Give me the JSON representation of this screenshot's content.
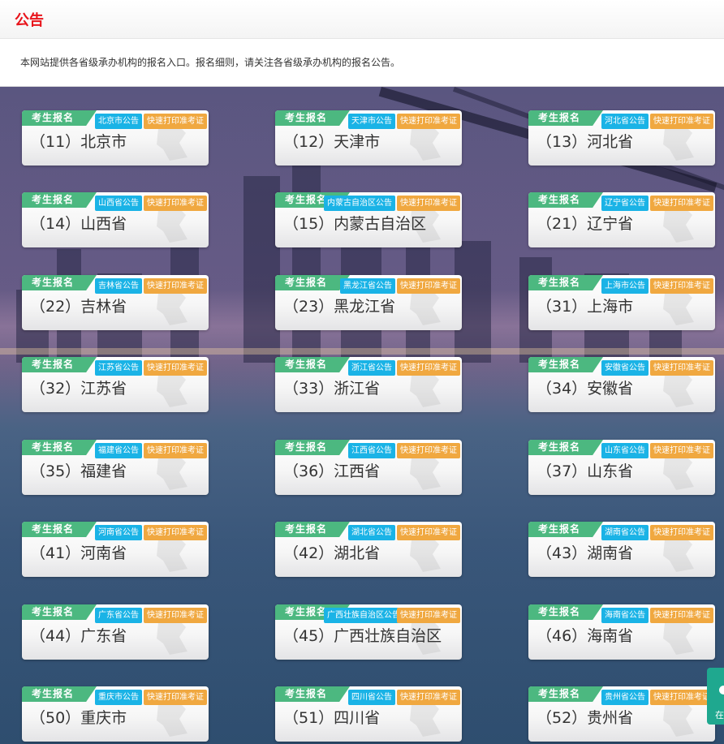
{
  "header": {
    "title": "公告",
    "notice": "本网站提供各省级承办机构的报名入口。报名细则，请关注各省级承办机构的报名公告。"
  },
  "card_common": {
    "ribbon": "考生报名",
    "print": "快速打印准考证"
  },
  "cards": [
    {
      "name": "（11）北京市",
      "notice": "北京市公告"
    },
    {
      "name": "（12）天津市",
      "notice": "天津市公告"
    },
    {
      "name": "（13）河北省",
      "notice": "河北省公告"
    },
    {
      "name": "（14）山西省",
      "notice": "山西省公告"
    },
    {
      "name": "（15）内蒙古自治区",
      "notice": "内蒙古自治区公告"
    },
    {
      "name": "（21）辽宁省",
      "notice": "辽宁省公告"
    },
    {
      "name": "（22）吉林省",
      "notice": "吉林省公告"
    },
    {
      "name": "（23）黑龙江省",
      "notice": "黑龙江省公告"
    },
    {
      "name": "（31）上海市",
      "notice": "上海市公告"
    },
    {
      "name": "（32）江苏省",
      "notice": "江苏省公告"
    },
    {
      "name": "（33）浙江省",
      "notice": "浙江省公告"
    },
    {
      "name": "（34）安徽省",
      "notice": "安徽省公告"
    },
    {
      "name": "（35）福建省",
      "notice": "福建省公告"
    },
    {
      "name": "（36）江西省",
      "notice": "江西省公告"
    },
    {
      "name": "（37）山东省",
      "notice": "山东省公告"
    },
    {
      "name": "（41）河南省",
      "notice": "河南省公告"
    },
    {
      "name": "（42）湖北省",
      "notice": "湖北省公告"
    },
    {
      "name": "（43）湖南省",
      "notice": "湖南省公告"
    },
    {
      "name": "（44）广东省",
      "notice": "广东省公告"
    },
    {
      "name": "（45）广西壮族自治区",
      "notice": "广西壮族自治区公告"
    },
    {
      "name": "（46）海南省",
      "notice": "海南省公告"
    },
    {
      "name": "（50）重庆市",
      "notice": "重庆市公告"
    },
    {
      "name": "（51）四川省",
      "notice": "四川省公告"
    },
    {
      "name": "（52）贵州省",
      "notice": "贵州省公告"
    }
  ],
  "float_button": {
    "label": "在",
    "icon": "chat-icon"
  },
  "colors": {
    "title_red": "#e8141b",
    "ribbon_green": "#4cb880",
    "tag_blue": "#1ab3e6",
    "tag_orange": "#f0a840",
    "float_teal": "#1fa88f"
  }
}
